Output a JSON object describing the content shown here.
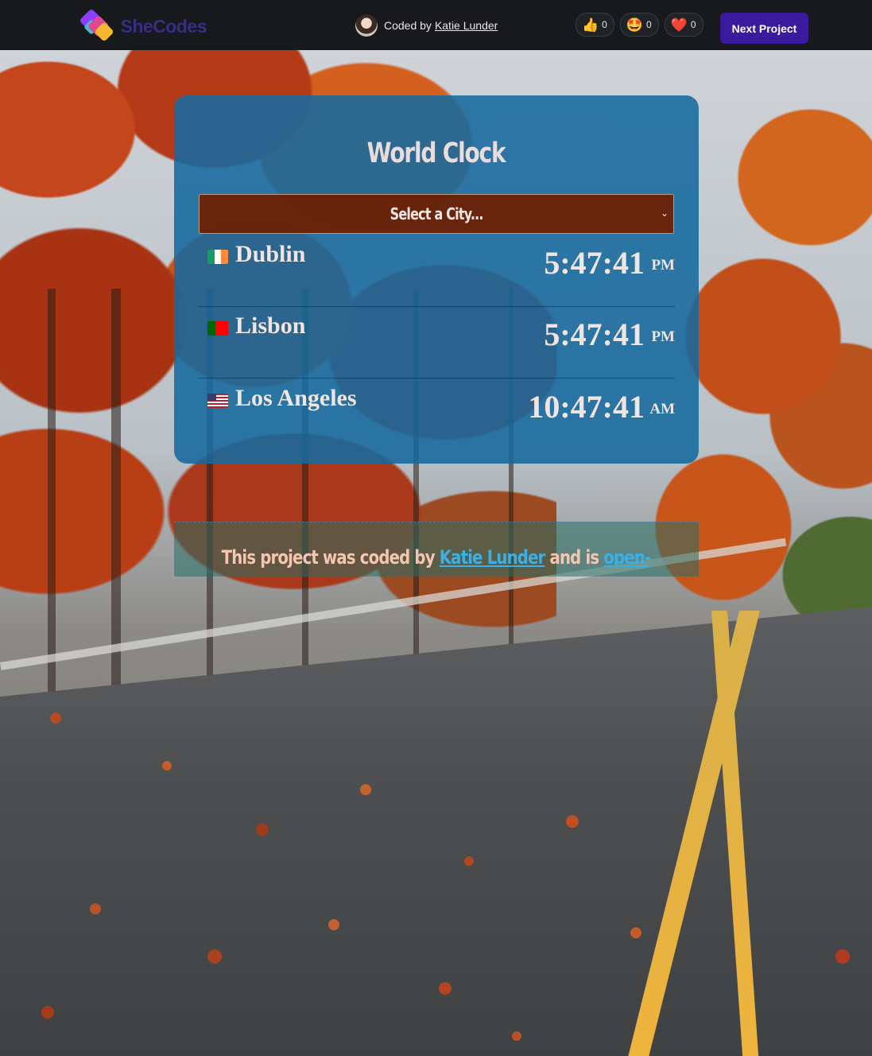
{
  "header": {
    "logo_text": "SheCodes",
    "coded_by_label": "Coded by",
    "author_name": "Katie Lunder",
    "reactions": [
      {
        "icon": "thumbs-up-icon",
        "emoji": "👍",
        "count": "0"
      },
      {
        "icon": "star-struck-icon",
        "emoji": "🤩",
        "count": "0"
      },
      {
        "icon": "heart-icon",
        "emoji": "❤️",
        "count": "0"
      }
    ],
    "next_button": "Next Project"
  },
  "clock": {
    "title": "World Clock",
    "select_placeholder": "Select a City...",
    "cities": [
      {
        "name": "Dublin",
        "flag": "ireland-flag",
        "time": "5:47:41",
        "ampm": "PM"
      },
      {
        "name": "Lisbon",
        "flag": "portugal-flag",
        "time": "5:47:41",
        "ampm": "PM"
      },
      {
        "name": "Los Angeles",
        "flag": "usa-flag",
        "time": "10:47:41",
        "ampm": "AM"
      }
    ]
  },
  "footer": {
    "text_before": "This project was coded by",
    "author_link": "Katie Lunder",
    "text_middle": "and is",
    "open_link": "open-"
  },
  "colors": {
    "card": "#16699e",
    "select_bg": "#6e1e00",
    "link": "#3bb0e6",
    "next_button": "#3b1a9e"
  }
}
